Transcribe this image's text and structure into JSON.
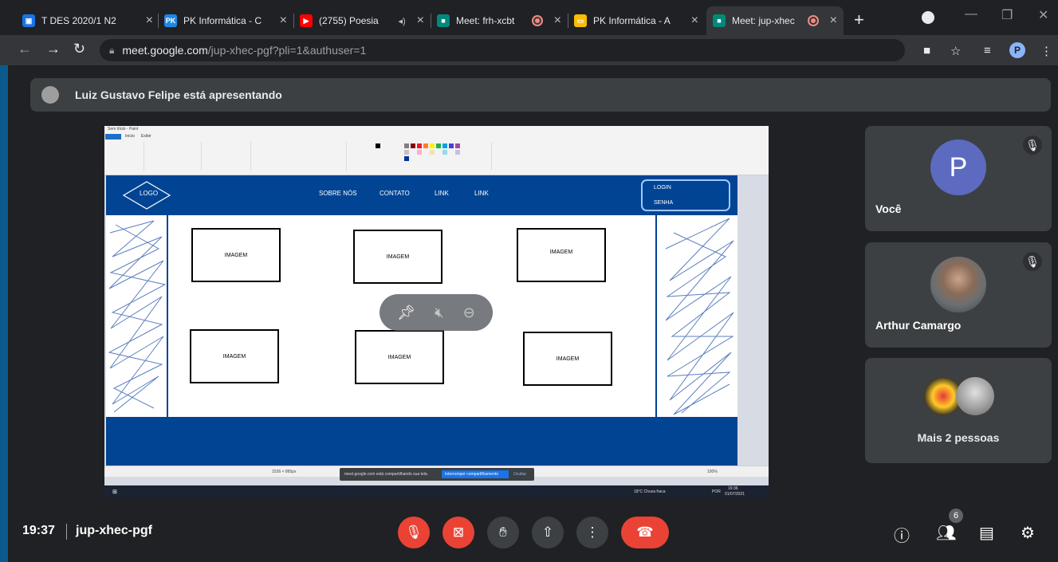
{
  "browser": {
    "tabs": [
      {
        "title": "T DES 2020/1 N2",
        "favicon_color": "#1a73e8",
        "favicon_icon": "people-icon"
      },
      {
        "title": "PK Informática - C",
        "favicon_color": "#1e88e5",
        "favicon_icon": "pk-logo-icon"
      },
      {
        "title": "(2755) Poesia",
        "favicon_color": "#ff0000",
        "favicon_icon": "youtube-icon",
        "audio": true
      },
      {
        "title": "Meet: frh-xcbt",
        "favicon_color": "#00897b",
        "favicon_icon": "meet-icon",
        "recording": true
      },
      {
        "title": "PK Informática - A",
        "favicon_color": "#fbbc04",
        "favicon_icon": "slides-icon"
      },
      {
        "title": "Meet: jup-xhec",
        "favicon_color": "#00897b",
        "favicon_icon": "meet-icon",
        "recording": true,
        "active": true
      }
    ],
    "url_host": "meet.google.com",
    "url_path": "/jup-xhec-pgf?pli=1&authuser=1",
    "profile_letter": "P"
  },
  "meet": {
    "presenting_text": "Luiz Gustavo Felipe está apresentando",
    "participants": [
      {
        "name": "Você",
        "avatar_letter": "P",
        "muted": true
      },
      {
        "name": "Arthur Camargo",
        "muted": true
      },
      {
        "name": "Mais 2 pessoas"
      }
    ],
    "time": "19:37",
    "meeting_code": "jup-xhec-pgf",
    "people_count": "6"
  },
  "shared": {
    "paint_title": "Sem título - Paint",
    "paint_tabs": [
      "Arquivo",
      "Início",
      "Exibir"
    ],
    "mockup": {
      "logo": "LOGO",
      "nav": [
        "SOBRE NÓS",
        "CONTATO",
        "LINK",
        "LINK"
      ],
      "login": "LOGIN",
      "senha": "SENHA",
      "image_label": "IMAGEM"
    },
    "status_size": "1536 × 865px",
    "zoom": "100%",
    "notify_text": "meet.google.com está compartilhando sua tela.",
    "notify_button": "Interromper compartilhamento",
    "notify_hide": "Ocultar",
    "taskbar_weather": "18°C Chuva fraca",
    "taskbar_time": "19:36",
    "taskbar_date": "01/07/2021",
    "taskbar_lang": "POR"
  }
}
